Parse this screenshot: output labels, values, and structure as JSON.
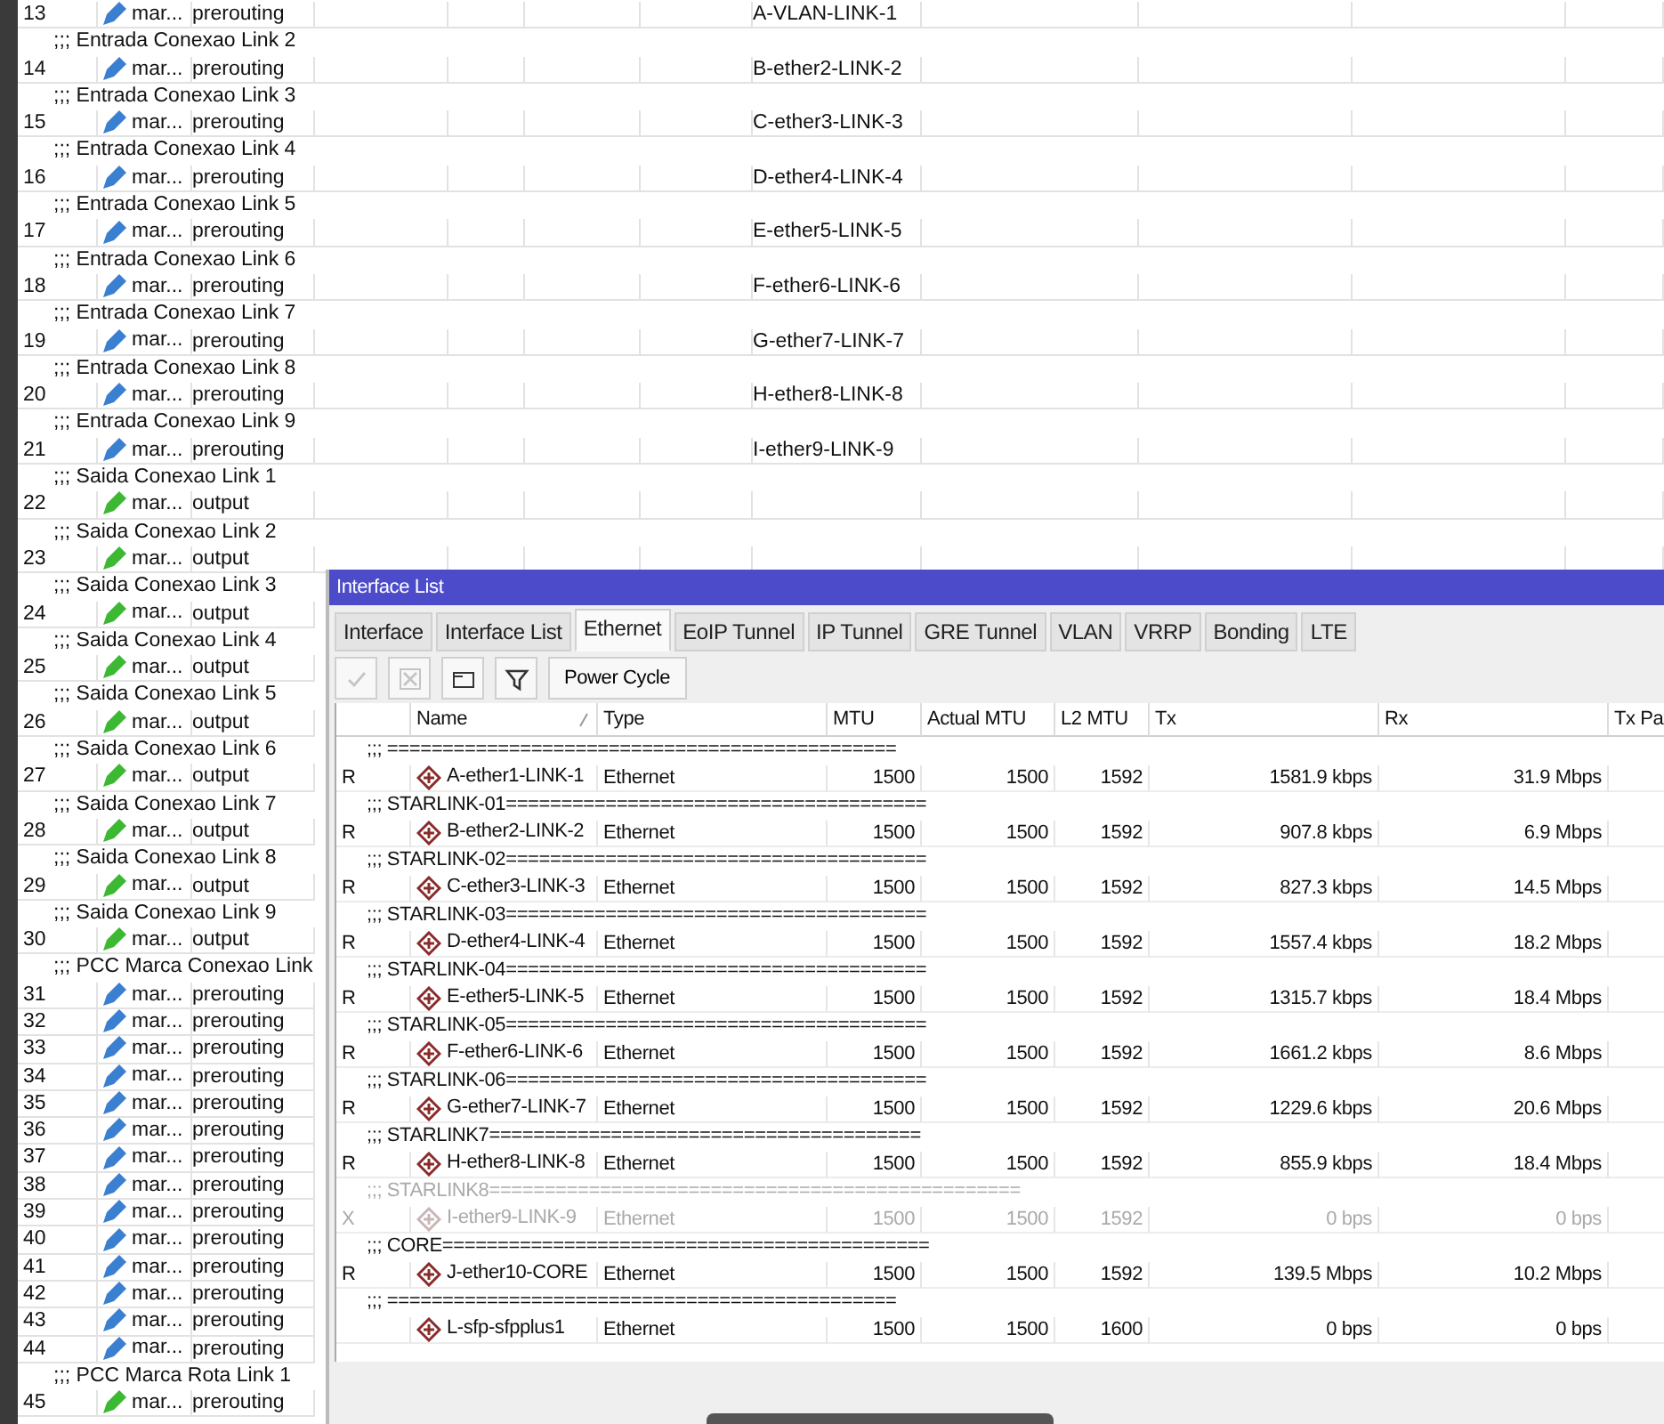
{
  "mangle_rules": {
    "rows": [
      {
        "kind": "rule",
        "number": "13",
        "action": "mar...",
        "chain": "prerouting",
        "interface": "A-VLAN-LINK-1",
        "color": "#3a7fd0"
      },
      {
        "kind": "comment",
        "text": ";;; Entrada Conexao Link 2"
      },
      {
        "kind": "rule",
        "number": "14",
        "action": "mar...",
        "chain": "prerouting",
        "interface": "B-ether2-LINK-2",
        "color": "#3a7fd0"
      },
      {
        "kind": "comment",
        "text": ";;; Entrada Conexao Link 3"
      },
      {
        "kind": "rule",
        "number": "15",
        "action": "mar...",
        "chain": "prerouting",
        "interface": "C-ether3-LINK-3",
        "color": "#3a7fd0"
      },
      {
        "kind": "comment",
        "text": ";;; Entrada Conexao Link 4"
      },
      {
        "kind": "rule",
        "number": "16",
        "action": "mar...",
        "chain": "prerouting",
        "interface": "D-ether4-LINK-4",
        "color": "#3a7fd0"
      },
      {
        "kind": "comment",
        "text": ";;; Entrada Conexao Link 5"
      },
      {
        "kind": "rule",
        "number": "17",
        "action": "mar...",
        "chain": "prerouting",
        "interface": "E-ether5-LINK-5",
        "color": "#3a7fd0"
      },
      {
        "kind": "comment",
        "text": ";;; Entrada Conexao Link 6"
      },
      {
        "kind": "rule",
        "number": "18",
        "action": "mar...",
        "chain": "prerouting",
        "interface": "F-ether6-LINK-6",
        "color": "#3a7fd0"
      },
      {
        "kind": "comment",
        "text": ";;; Entrada Conexao Link 7"
      },
      {
        "kind": "rule",
        "number": "19",
        "action": "mar...",
        "chain": "prerouting",
        "interface": "G-ether7-LINK-7",
        "color": "#3a7fd0"
      },
      {
        "kind": "comment",
        "text": ";;; Entrada Conexao Link 8"
      },
      {
        "kind": "rule",
        "number": "20",
        "action": "mar...",
        "chain": "prerouting",
        "interface": "H-ether8-LINK-8",
        "color": "#3a7fd0"
      },
      {
        "kind": "comment",
        "text": ";;; Entrada Conexao Link 9"
      },
      {
        "kind": "rule",
        "number": "21",
        "action": "mar...",
        "chain": "prerouting",
        "interface": "I-ether9-LINK-9",
        "color": "#3a7fd0"
      },
      {
        "kind": "comment",
        "text": ";;; Saida Conexao Link 1"
      },
      {
        "kind": "rule",
        "number": "22",
        "action": "mar...",
        "chain": "output",
        "color": "#3cb832"
      },
      {
        "kind": "comment",
        "text": ";;; Saida Conexao Link 2"
      },
      {
        "kind": "rule",
        "number": "23",
        "action": "mar...",
        "chain": "output",
        "color": "#3cb832"
      },
      {
        "kind": "comment",
        "text": ";;; Saida Conexao Link 3"
      },
      {
        "kind": "rule",
        "number": "24",
        "action": "mar...",
        "chain": "output",
        "color": "#3cb832"
      },
      {
        "kind": "comment",
        "text": ";;; Saida Conexao Link 4"
      },
      {
        "kind": "rule",
        "number": "25",
        "action": "mar...",
        "chain": "output",
        "color": "#3cb832"
      },
      {
        "kind": "comment",
        "text": ";;; Saida Conexao Link 5"
      },
      {
        "kind": "rule",
        "number": "26",
        "action": "mar...",
        "chain": "output",
        "color": "#3cb832"
      },
      {
        "kind": "comment",
        "text": ";;; Saida Conexao Link 6"
      },
      {
        "kind": "rule",
        "number": "27",
        "action": "mar...",
        "chain": "output",
        "color": "#3cb832"
      },
      {
        "kind": "comment",
        "text": ";;; Saida Conexao Link 7"
      },
      {
        "kind": "rule",
        "number": "28",
        "action": "mar...",
        "chain": "output",
        "color": "#3cb832"
      },
      {
        "kind": "comment",
        "text": ";;; Saida Conexao Link 8"
      },
      {
        "kind": "rule",
        "number": "29",
        "action": "mar...",
        "chain": "output",
        "color": "#3cb832"
      },
      {
        "kind": "comment",
        "text": ";;; Saida Conexao Link 9"
      },
      {
        "kind": "rule",
        "number": "30",
        "action": "mar...",
        "chain": "output",
        "color": "#3cb832"
      },
      {
        "kind": "comment",
        "text": ";;; PCC Marca Conexao Link"
      },
      {
        "kind": "rule",
        "number": "31",
        "action": "mar...",
        "chain": "prerouting",
        "color": "#3a7fd0"
      },
      {
        "kind": "rule",
        "number": "32",
        "action": "mar...",
        "chain": "prerouting",
        "color": "#3a7fd0"
      },
      {
        "kind": "rule",
        "number": "33",
        "action": "mar...",
        "chain": "prerouting",
        "color": "#3a7fd0"
      },
      {
        "kind": "rule",
        "number": "34",
        "action": "mar...",
        "chain": "prerouting",
        "color": "#3a7fd0"
      },
      {
        "kind": "rule",
        "number": "35",
        "action": "mar...",
        "chain": "prerouting",
        "color": "#3a7fd0"
      },
      {
        "kind": "rule",
        "number": "36",
        "action": "mar...",
        "chain": "prerouting",
        "color": "#3a7fd0"
      },
      {
        "kind": "rule",
        "number": "37",
        "action": "mar...",
        "chain": "prerouting",
        "color": "#3a7fd0"
      },
      {
        "kind": "rule",
        "number": "38",
        "action": "mar...",
        "chain": "prerouting",
        "color": "#3a7fd0"
      },
      {
        "kind": "rule",
        "number": "39",
        "action": "mar...",
        "chain": "prerouting",
        "color": "#3a7fd0"
      },
      {
        "kind": "rule",
        "number": "40",
        "action": "mar...",
        "chain": "prerouting",
        "color": "#3a7fd0"
      },
      {
        "kind": "rule",
        "number": "41",
        "action": "mar...",
        "chain": "prerouting",
        "color": "#3a7fd0"
      },
      {
        "kind": "rule",
        "number": "42",
        "action": "mar...",
        "chain": "prerouting",
        "color": "#3a7fd0"
      },
      {
        "kind": "rule",
        "number": "43",
        "action": "mar...",
        "chain": "prerouting",
        "color": "#3a7fd0"
      },
      {
        "kind": "rule",
        "number": "44",
        "action": "mar...",
        "chain": "prerouting",
        "color": "#3a7fd0"
      },
      {
        "kind": "comment",
        "text": ";;; PCC Marca Rota Link 1"
      },
      {
        "kind": "rule",
        "number": "45",
        "action": "mar...",
        "chain": "prerouting",
        "color": "#3cb832"
      }
    ]
  },
  "interface_window": {
    "title": "Interface List",
    "tabs": [
      {
        "label": "Interface",
        "selected": false
      },
      {
        "label": "Interface List",
        "selected": false
      },
      {
        "label": "Ethernet",
        "selected": true
      },
      {
        "label": "EoIP Tunnel",
        "selected": false
      },
      {
        "label": "IP Tunnel",
        "selected": false
      },
      {
        "label": "GRE Tunnel",
        "selected": false
      },
      {
        "label": "VLAN",
        "selected": false
      },
      {
        "label": "VRRP",
        "selected": false
      },
      {
        "label": "Bonding",
        "selected": false
      },
      {
        "label": "LTE",
        "selected": false
      }
    ],
    "toolbar": {
      "buttons": [
        {
          "kind": "enable",
          "disabled": true
        },
        {
          "kind": "disable",
          "disabled": true
        },
        {
          "kind": "comment",
          "disabled": false
        },
        {
          "kind": "filter",
          "disabled": false
        }
      ],
      "power_cycle": "Power Cycle"
    },
    "columns": [
      {
        "label": "Name",
        "sorted": true
      },
      {
        "label": "Type",
        "sorted": false
      },
      {
        "label": "MTU",
        "sorted": false
      },
      {
        "label": "Actual MTU",
        "sorted": false
      },
      {
        "label": "L2 MTU",
        "sorted": false
      },
      {
        "label": "Tx",
        "sorted": false
      },
      {
        "label": "Rx",
        "sorted": false
      },
      {
        "label": "Tx Pa",
        "sorted": false
      }
    ],
    "rows": [
      {
        "kind": "comment",
        "text": ";;; ==============================================",
        "disabled": false
      },
      {
        "kind": "interface",
        "flag": "R",
        "name": "A-ether1-LINK-1",
        "type": "Ethernet",
        "mtu": "1500",
        "actual_mtu": "1500",
        "l2mtu": "1592",
        "tx": "1581.9 kbps",
        "rx": "31.9 Mbps",
        "disabled": false
      },
      {
        "kind": "comment",
        "text": ";;; STARLINK-01======================================",
        "disabled": false
      },
      {
        "kind": "interface",
        "flag": "R",
        "name": "B-ether2-LINK-2",
        "type": "Ethernet",
        "mtu": "1500",
        "actual_mtu": "1500",
        "l2mtu": "1592",
        "tx": "907.8 kbps",
        "rx": "6.9 Mbps",
        "disabled": false
      },
      {
        "kind": "comment",
        "text": ";;; STARLINK-02======================================",
        "disabled": false
      },
      {
        "kind": "interface",
        "flag": "R",
        "name": "C-ether3-LINK-3",
        "type": "Ethernet",
        "mtu": "1500",
        "actual_mtu": "1500",
        "l2mtu": "1592",
        "tx": "827.3 kbps",
        "rx": "14.5 Mbps",
        "disabled": false
      },
      {
        "kind": "comment",
        "text": ";;; STARLINK-03======================================",
        "disabled": false
      },
      {
        "kind": "interface",
        "flag": "R",
        "name": "D-ether4-LINK-4",
        "type": "Ethernet",
        "mtu": "1500",
        "actual_mtu": "1500",
        "l2mtu": "1592",
        "tx": "1557.4 kbps",
        "rx": "18.2 Mbps",
        "disabled": false
      },
      {
        "kind": "comment",
        "text": ";;; STARLINK-04======================================",
        "disabled": false
      },
      {
        "kind": "interface",
        "flag": "R",
        "name": "E-ether5-LINK-5",
        "type": "Ethernet",
        "mtu": "1500",
        "actual_mtu": "1500",
        "l2mtu": "1592",
        "tx": "1315.7 kbps",
        "rx": "18.4 Mbps",
        "disabled": false
      },
      {
        "kind": "comment",
        "text": ";;; STARLINK-05======================================",
        "disabled": false
      },
      {
        "kind": "interface",
        "flag": "R",
        "name": "F-ether6-LINK-6",
        "type": "Ethernet",
        "mtu": "1500",
        "actual_mtu": "1500",
        "l2mtu": "1592",
        "tx": "1661.2 kbps",
        "rx": "8.6 Mbps",
        "disabled": false
      },
      {
        "kind": "comment",
        "text": ";;; STARLINK-06======================================",
        "disabled": false
      },
      {
        "kind": "interface",
        "flag": "R",
        "name": "G-ether7-LINK-7",
        "type": "Ethernet",
        "mtu": "1500",
        "actual_mtu": "1500",
        "l2mtu": "1592",
        "tx": "1229.6 kbps",
        "rx": "20.6 Mbps",
        "disabled": false
      },
      {
        "kind": "comment",
        "text": ";;; STARLINK7=======================================",
        "disabled": false
      },
      {
        "kind": "interface",
        "flag": "R",
        "name": "H-ether8-LINK-8",
        "type": "Ethernet",
        "mtu": "1500",
        "actual_mtu": "1500",
        "l2mtu": "1592",
        "tx": "855.9 kbps",
        "rx": "18.4 Mbps",
        "disabled": false
      },
      {
        "kind": "comment",
        "text": ";;; STARLINK8================================================",
        "disabled": true
      },
      {
        "kind": "interface",
        "flag": "X",
        "name": "I-ether9-LINK-9",
        "type": "Ethernet",
        "mtu": "1500",
        "actual_mtu": "1500",
        "l2mtu": "1592",
        "tx": "0 bps",
        "rx": "0 bps",
        "disabled": true
      },
      {
        "kind": "comment",
        "text": ";;; CORE============================================",
        "disabled": false
      },
      {
        "kind": "interface",
        "flag": "R",
        "name": "J-ether10-CORE",
        "type": "Ethernet",
        "mtu": "1500",
        "actual_mtu": "1500",
        "l2mtu": "1592",
        "tx": "139.5 Mbps",
        "rx": "10.2 Mbps",
        "disabled": false
      },
      {
        "kind": "comment",
        "text": ";;; ==============================================",
        "disabled": false
      },
      {
        "kind": "interface",
        "name": "L-sfp-sfpplus1",
        "type": "Ethernet",
        "mtu": "1500",
        "actual_mtu": "1500",
        "l2mtu": "1600",
        "tx": "0 bps",
        "rx": "0 bps",
        "disabled": false
      }
    ]
  }
}
